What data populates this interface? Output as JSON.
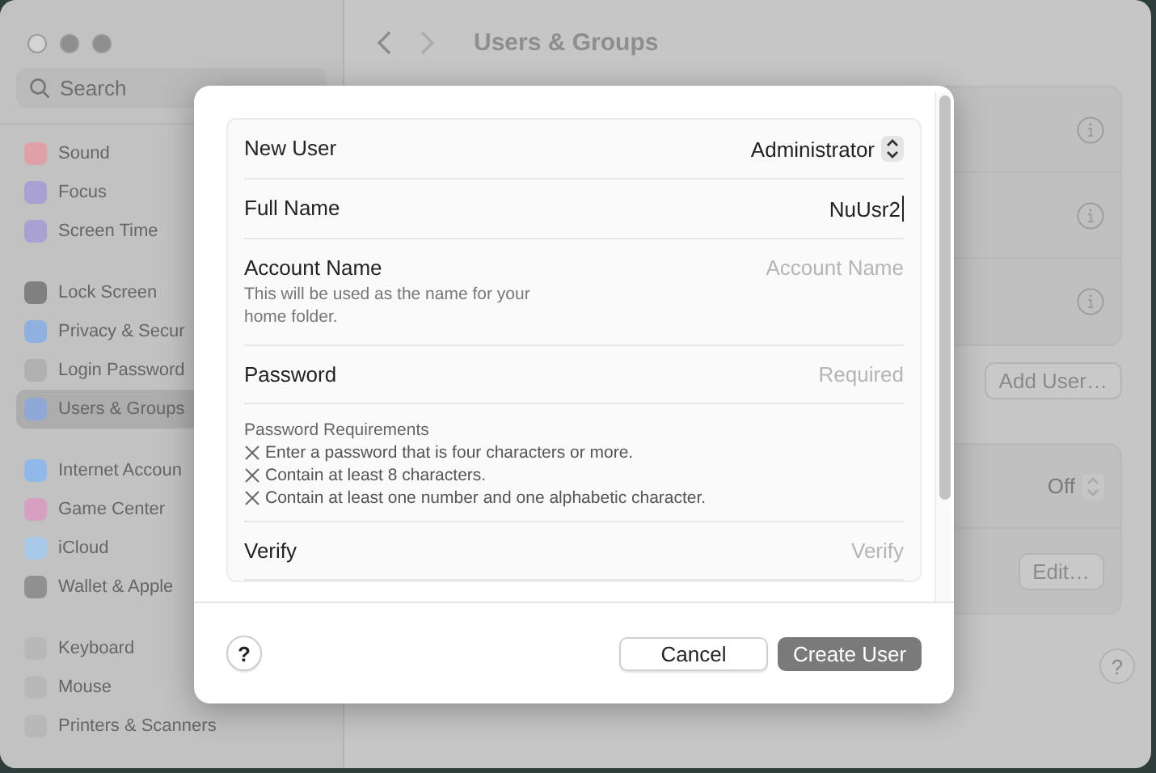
{
  "sidebar": {
    "search": {
      "placeholder": "Search"
    },
    "groups": [
      {
        "items": [
          {
            "label": "Sound",
            "color": "#e0a0a8",
            "selected": false
          },
          {
            "label": "Focus",
            "color": "#a8a0d0",
            "selected": false
          },
          {
            "label": "Screen Time",
            "color": "#a8a0d0",
            "selected": false
          }
        ]
      },
      {
        "items": [
          {
            "label": "Lock Screen",
            "color": "#808080",
            "selected": false
          },
          {
            "label": "Privacy & Secur",
            "color": "#90b0e0",
            "selected": false
          },
          {
            "label": "Login Password",
            "color": "#b0b0b0",
            "selected": false
          },
          {
            "label": "Users & Groups",
            "color": "#90a8d8",
            "selected": true
          }
        ]
      },
      {
        "items": [
          {
            "label": "Internet Accoun",
            "color": "#90b8e8",
            "selected": false
          },
          {
            "label": "Game Center",
            "color": "#d8a0c0",
            "selected": false
          },
          {
            "label": "iCloud",
            "color": "#a8c8e8",
            "selected": false
          },
          {
            "label": "Wallet & Apple",
            "color": "#909090",
            "selected": false
          }
        ]
      },
      {
        "items": [
          {
            "label": "Keyboard",
            "color": "#b8b8b8",
            "selected": false
          },
          {
            "label": "Mouse",
            "color": "#b8b8b8",
            "selected": false
          },
          {
            "label": "Printers & Scanners",
            "color": "#b8b8b8",
            "selected": false
          }
        ]
      }
    ]
  },
  "header": {
    "title": "Users & Groups"
  },
  "content": {
    "add_user_button": "Add User…",
    "auto_login": {
      "value": "Off"
    },
    "edit_button": "Edit…"
  },
  "dialog": {
    "fields": [
      {
        "kind": "popup",
        "label": "New User",
        "value": "Administrator"
      },
      {
        "kind": "text",
        "label": "Full Name",
        "value": "NuUsr2",
        "focused": true
      },
      {
        "kind": "text",
        "label": "Account Name",
        "placeholder": "Account Name",
        "hint": "This will be used as the name for your home folder.",
        "focused": false
      },
      {
        "kind": "text",
        "label": "Password",
        "placeholder": "Required",
        "focused": false
      },
      {
        "kind": "requirements",
        "title": "Password Requirements",
        "items": [
          {
            "text": "Enter a password that is four characters or more.",
            "met": false
          },
          {
            "text": "Contain at least 8 characters.",
            "met": false
          },
          {
            "text": "Contain at least one number and one alphabetic character.",
            "met": false
          }
        ]
      },
      {
        "kind": "text",
        "label": "Verify",
        "placeholder": "Verify",
        "focused": false
      }
    ],
    "help": "?",
    "cancel": "Cancel",
    "create": "Create User"
  },
  "help": "?"
}
